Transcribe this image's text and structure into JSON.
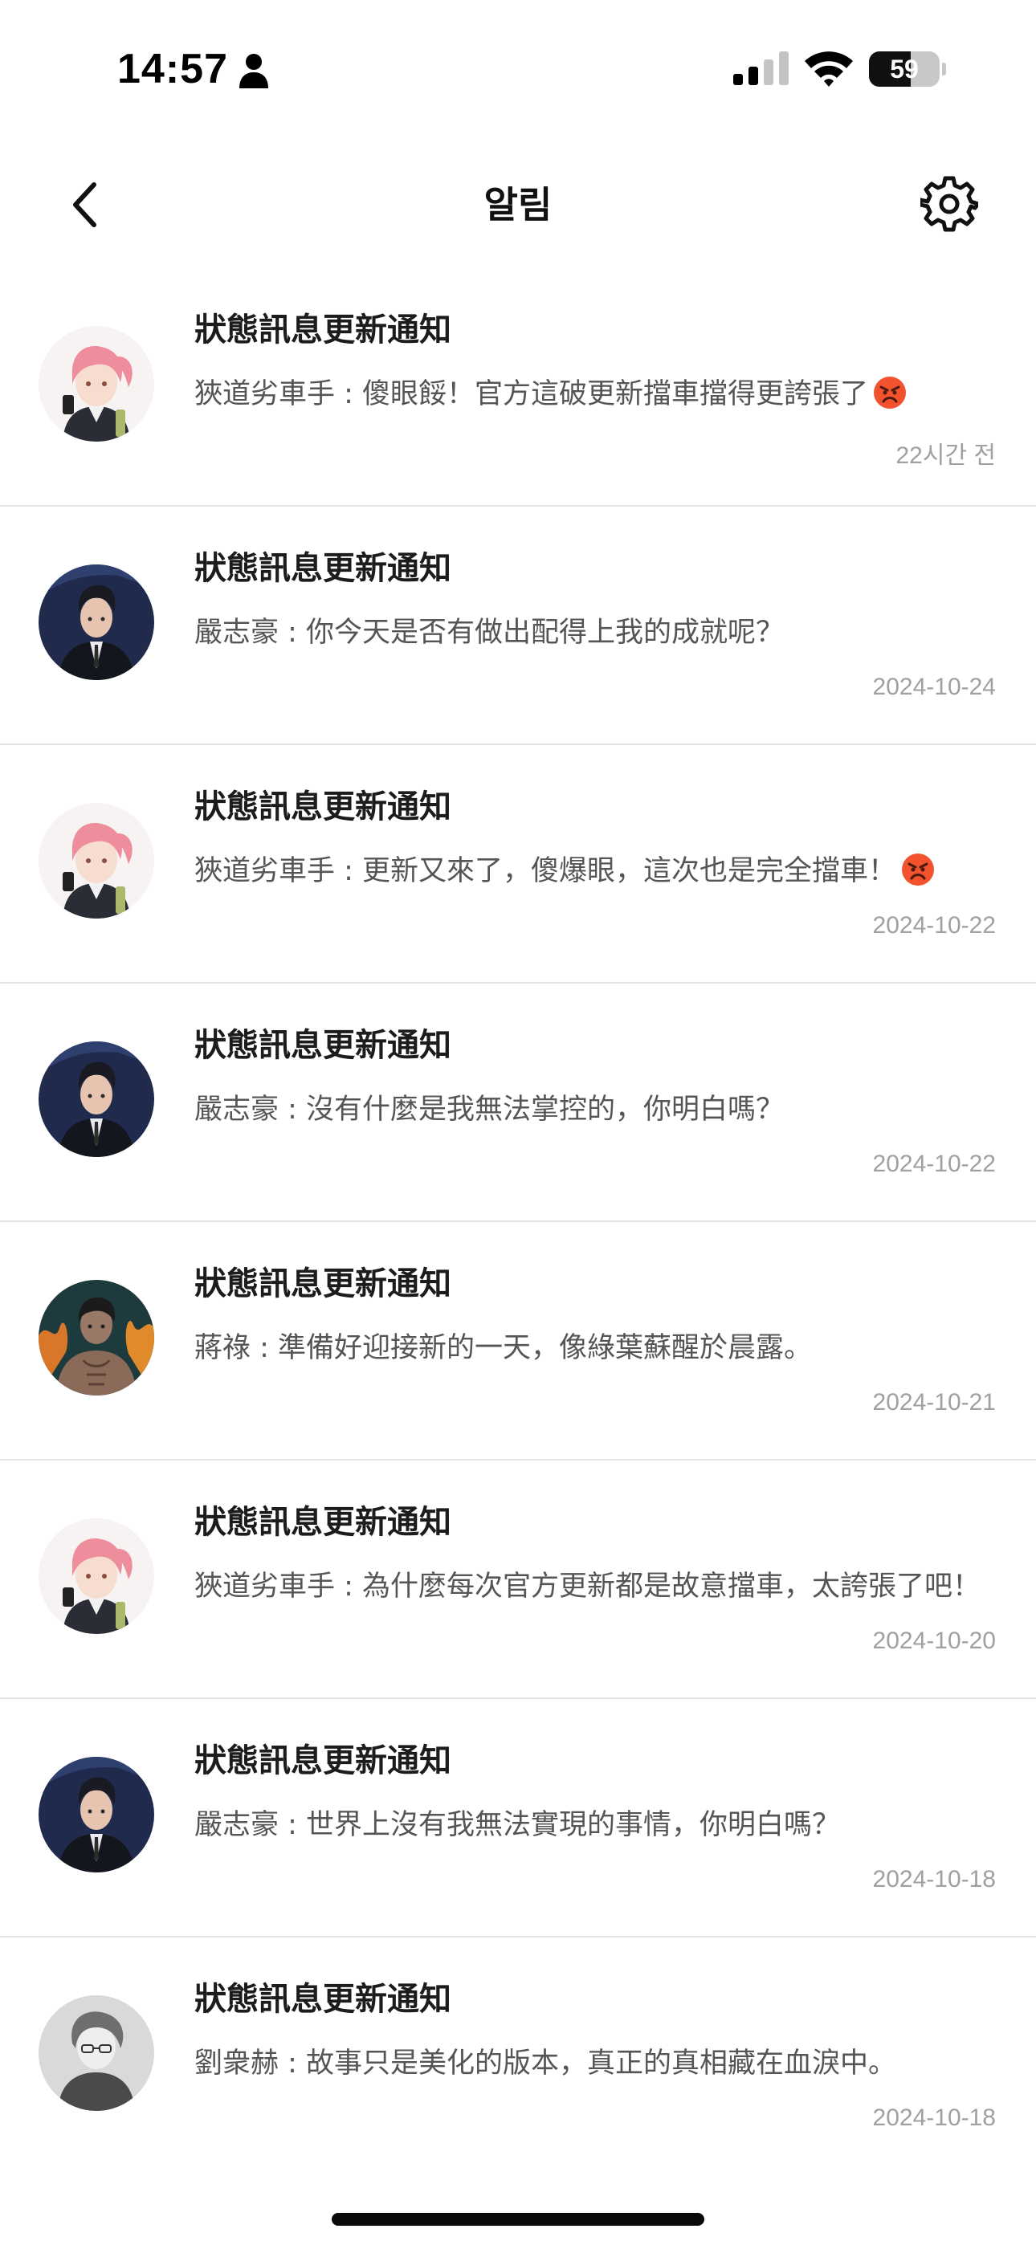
{
  "status_bar": {
    "time": "14:57",
    "battery_level": "59",
    "battery_fraction": 0.59
  },
  "header": {
    "title": "알림"
  },
  "notifications": [
    {
      "avatar": "pink-hair-girl",
      "title": "狀態訊息更新通知",
      "message": "狹道劣車手 : 傻眼餒！官方這破更新擋車擋得更誇張了",
      "emoji": "angry-face",
      "time": "22시간 전"
    },
    {
      "avatar": "dark-suit-man",
      "title": "狀態訊息更新通知",
      "message": "嚴志豪 : 你今天是否有做出配得上我的成就呢？",
      "time": "2024-10-24"
    },
    {
      "avatar": "pink-hair-girl",
      "title": "狀態訊息更新通知",
      "message": "狹道劣車手 : 更新又來了，傻爆眼，這次也是完全擋車！",
      "emoji": "angry-face",
      "time": "2024-10-22"
    },
    {
      "avatar": "dark-suit-man",
      "title": "狀態訊息更新通知",
      "message": "嚴志豪 : 沒有什麼是我無法掌控的，你明白嗎？",
      "time": "2024-10-22"
    },
    {
      "avatar": "muscular-man-fire",
      "title": "狀態訊息更新通知",
      "message": "蔣祿 : 準備好迎接新的一天，像綠葉蘇醒於晨露。",
      "time": "2024-10-21"
    },
    {
      "avatar": "pink-hair-girl",
      "title": "狀態訊息更新通知",
      "message": "狹道劣車手 : 為什麼每次官方更新都是故意擋車，太誇張了吧！",
      "time": "2024-10-20"
    },
    {
      "avatar": "dark-suit-man",
      "title": "狀態訊息更新通知",
      "message": "嚴志豪 : 世界上沒有我無法實現的事情，你明白嗎？",
      "time": "2024-10-18"
    },
    {
      "avatar": "grey-sketch-man",
      "title": "狀態訊息更新通知",
      "message": "劉衆赫 : 故事只是美化的版本，真正的真相藏在血淚中。",
      "time": "2024-10-18"
    }
  ],
  "colors": {
    "background": "#ffffff",
    "divider": "#e4e4e4",
    "title_text": "#1c1c1c",
    "message_text": "#555555",
    "time_text": "#a0a0a0"
  }
}
